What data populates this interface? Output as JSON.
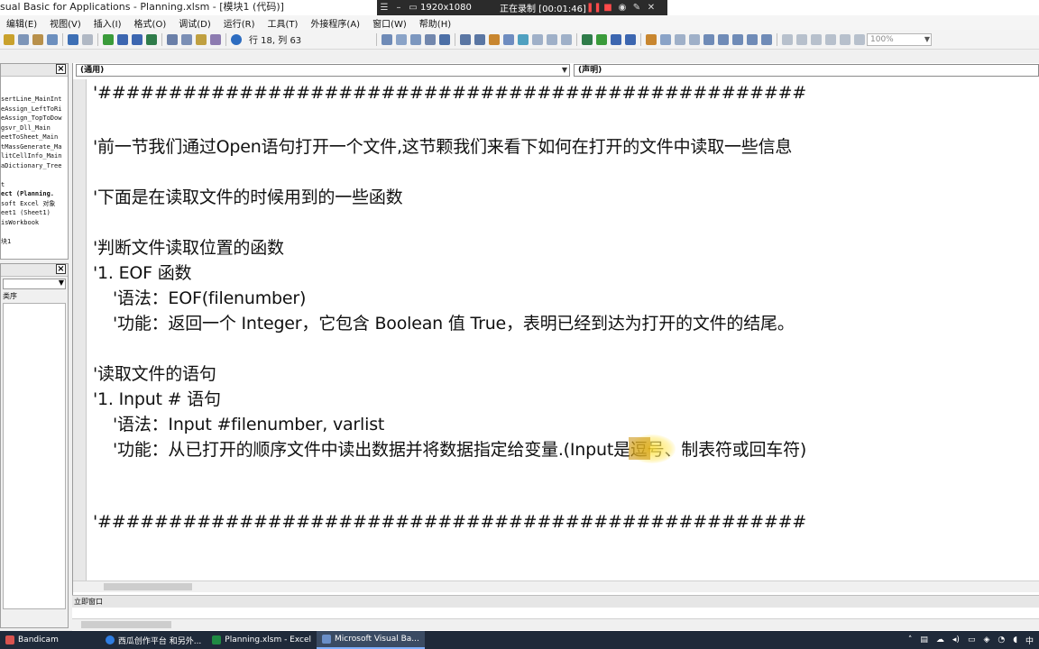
{
  "window": {
    "title": "sual Basic for Applications - Planning.xlsm - [模块1 (代码)]"
  },
  "recorder": {
    "resolution": "1920x1080",
    "status": "正在录制 [00:01:46]"
  },
  "menubar": {
    "items": [
      "编辑(E)",
      "视图(V)",
      "插入(I)",
      "格式(O)",
      "调试(D)",
      "运行(R)",
      "工具(T)",
      "外接程序(A)",
      "窗口(W)",
      "帮助(H)"
    ]
  },
  "toolbar": {
    "position": "行 18, 列 63",
    "zoom": "100%"
  },
  "project": {
    "items": [
      {
        "text": "sertLine_MainInt",
        "bold": false
      },
      {
        "text": "eAssign_LeftToRi",
        "bold": false
      },
      {
        "text": "eAssign_TopToDow",
        "bold": false
      },
      {
        "text": "gsvr_Dll_Main",
        "bold": false
      },
      {
        "text": "eetToSheet_Main",
        "bold": false
      },
      {
        "text": "tMassGenerate_Ma",
        "bold": false
      },
      {
        "text": "litCellInfo_Main",
        "bold": false
      },
      {
        "text": "aDictionary_Tree",
        "bold": false
      },
      {
        "text": "",
        "bold": false
      },
      {
        "text": "t",
        "bold": false
      },
      {
        "text": "ect (Planning.",
        "bold": true
      },
      {
        "text": "soft Excel 对象",
        "bold": false
      },
      {
        "text": "eet1 (Sheet1)",
        "bold": false
      },
      {
        "text": "isWorkbook",
        "bold": false
      },
      {
        "text": "",
        "bold": false
      },
      {
        "text": "块1",
        "bold": false
      }
    ]
  },
  "properties": {
    "tab": "类序"
  },
  "code": {
    "object_combo": "(通用)",
    "proc_combo": "(声明)",
    "lines": [
      {
        "text": "'##################################################",
        "indent": false
      },
      {
        "text": "'前一节我们通过Open语句打开一个文件,这节颗我们来看下如何在打开的文件中读取一些信息",
        "indent": false
      },
      {
        "text": "'下面是在读取文件的时候用到的一些函数",
        "indent": false
      },
      {
        "text": "'判断文件读取位置的函数",
        "indent": false
      },
      {
        "text": "'1. EOF 函数",
        "indent": false
      },
      {
        "text": "'语法：EOF(filenumber)",
        "indent": true
      },
      {
        "text": "'功能：返回一个 Integer，它包含 Boolean 值 True，表明已经到达为打开的文件的结尾。",
        "indent": true
      },
      {
        "text": "'读取文件的语句",
        "indent": false
      },
      {
        "text": "'1. Input # 语句",
        "indent": false
      },
      {
        "text": "'语法：Input #filenumber, varlist",
        "indent": true
      },
      {
        "text": "'功能：从已打开的顺序文件中读出数据并将数据指定给变量.(Input是逗号、制表符或回车符)",
        "indent": true
      },
      {
        "text": "'##################################################",
        "indent": false
      }
    ]
  },
  "immediate": {
    "title": "立即窗口"
  },
  "taskbar": {
    "items": [
      {
        "label": "Bandicam",
        "active": false,
        "color": "#d9534f"
      },
      {
        "label": "西瓜创作平台 和另外...",
        "active": false,
        "color": "#2f7de1"
      },
      {
        "label": "Planning.xlsm - Excel",
        "active": false,
        "color": "#1f8a43"
      },
      {
        "label": "Microsoft Visual Ba...",
        "active": true,
        "color": "#6a8fc8"
      }
    ],
    "ime": "中"
  }
}
